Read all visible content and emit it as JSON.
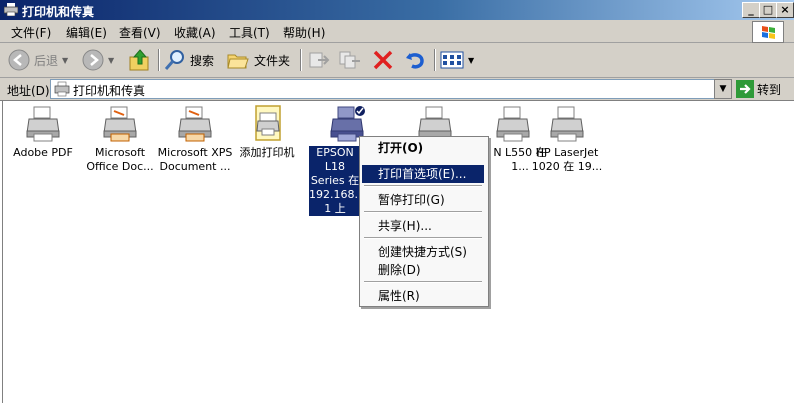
{
  "window": {
    "title": "打印机和传真"
  },
  "title_buttons": {
    "minimize": "_",
    "maximize": "□",
    "close": "×"
  },
  "menu": [
    {
      "label": "文件(F)"
    },
    {
      "label": "编辑(E)"
    },
    {
      "label": "查看(V)"
    },
    {
      "label": "收藏(A)"
    },
    {
      "label": "工具(T)"
    },
    {
      "label": "帮助(H)"
    }
  ],
  "toolbar": {
    "back_label": "后退",
    "search_label": "搜索",
    "folders_label": "文件夹"
  },
  "address": {
    "label": "地址(D)",
    "value": "打印机和传真",
    "go_label": "转到"
  },
  "printers": [
    {
      "name": "Adobe PDF"
    },
    {
      "name": "Microsoft Office Doc..."
    },
    {
      "name": "Microsoft XPS Document ..."
    },
    {
      "name": "添加打印机"
    },
    {
      "name": "EPSON L18 Series 在 192.168.1 1 上"
    },
    {
      "name": ""
    },
    {
      "name": "N L550 在 1..."
    },
    {
      "name": "HP LaserJet 1020 在 19..."
    }
  ],
  "context_menu": [
    {
      "label": "打开(O)"
    },
    {
      "label": "打印首选项(E)..."
    },
    {
      "label": "暂停打印(G)"
    },
    {
      "label": "共享(H)..."
    },
    {
      "label": "创建快捷方式(S)"
    },
    {
      "label": "删除(D)"
    },
    {
      "label": "属性(R)"
    }
  ],
  "colors": {
    "title_bar": "#0a246a",
    "selection": "#0a246a",
    "chrome": "#d4d0c8"
  }
}
